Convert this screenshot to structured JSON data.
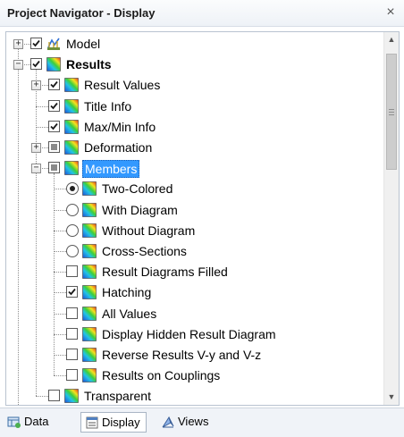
{
  "window": {
    "title": "Project Navigator - Display",
    "close_glyph": "×"
  },
  "tree": {
    "items": [
      {
        "label": "Model",
        "check": "checked",
        "expander": "plus",
        "icon": "model-icon"
      },
      {
        "label": "Results",
        "check": "checked",
        "expander": "minus",
        "icon": "results-icon",
        "bold": true
      },
      {
        "label": "Result Values",
        "check": "checked",
        "expander": "plus",
        "icon": "results-icon"
      },
      {
        "label": "Title Info",
        "check": "checked",
        "icon": "results-icon"
      },
      {
        "label": "Max/Min Info",
        "check": "checked",
        "icon": "results-icon"
      },
      {
        "label": "Deformation",
        "check": "indeterminate",
        "expander": "plus",
        "icon": "results-icon"
      },
      {
        "label": "Members",
        "check": "indeterminate",
        "expander": "minus",
        "icon": "results-icon",
        "selected": true
      },
      {
        "label": "Two-Colored",
        "radio": "selected",
        "icon": "results-icon"
      },
      {
        "label": "With Diagram",
        "radio": "unselected",
        "icon": "results-icon"
      },
      {
        "label": "Without Diagram",
        "radio": "unselected",
        "icon": "results-icon"
      },
      {
        "label": "Cross-Sections",
        "radio": "unselected",
        "icon": "results-icon"
      },
      {
        "label": "Result Diagrams Filled",
        "check": "unchecked",
        "icon": "results-icon"
      },
      {
        "label": "Hatching",
        "check": "checked",
        "icon": "results-icon"
      },
      {
        "label": "All Values",
        "check": "unchecked",
        "icon": "results-icon"
      },
      {
        "label": "Display Hidden Result Diagram",
        "check": "unchecked",
        "icon": "results-icon"
      },
      {
        "label": "Reverse Results V-y and V-z",
        "check": "unchecked",
        "icon": "results-icon"
      },
      {
        "label": "Results on Couplings",
        "check": "unchecked",
        "icon": "results-icon"
      },
      {
        "label": "Transparent",
        "check": "unchecked",
        "icon": "results-icon"
      }
    ]
  },
  "scrollbar": {
    "up_glyph": "▲",
    "down_glyph": "▼"
  },
  "tabs": [
    {
      "label": "Data",
      "icon": "data-icon"
    },
    {
      "label": "Display",
      "icon": "display-icon",
      "active": true
    },
    {
      "label": "Views",
      "icon": "views-icon"
    }
  ],
  "colors": {
    "selection": "#3399ff",
    "panel_border": "#b9c3d0",
    "tab_bar": "#f0f3f8"
  }
}
